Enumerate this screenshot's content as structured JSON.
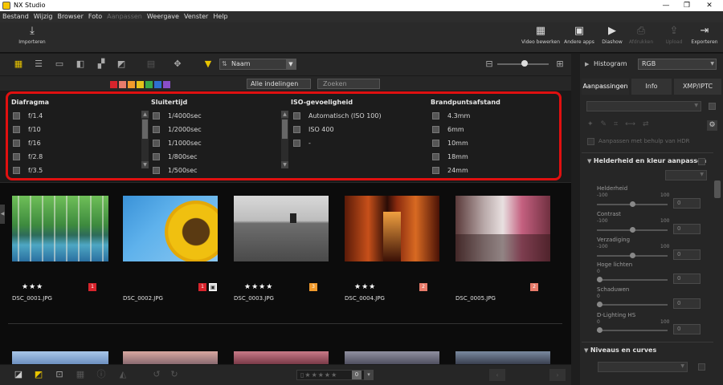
{
  "title_bar": {
    "app_title": "NX Studio",
    "minimize": "—",
    "maximize": "❐",
    "close": "✕"
  },
  "menu": [
    {
      "label": "Bestand",
      "enabled": true
    },
    {
      "label": "Wijzig",
      "enabled": true
    },
    {
      "label": "Browser",
      "enabled": true
    },
    {
      "label": "Foto",
      "enabled": true
    },
    {
      "label": "Aanpassen",
      "enabled": false
    },
    {
      "label": "Weergave",
      "enabled": true
    },
    {
      "label": "Venster",
      "enabled": true
    },
    {
      "label": "Help",
      "enabled": true
    }
  ],
  "toolbar": {
    "import": "Importeren",
    "movie_edit": "Video bewerken",
    "other_apps": "Andere apps",
    "slideshow": "Diashow",
    "print": "Afdrukken",
    "upload": "Upload",
    "export": "Exporteren"
  },
  "sort": {
    "label": "Naam"
  },
  "filter_bar": {
    "all_layouts": "Alle indelingen",
    "search_placeholder": "Zoeken"
  },
  "filter_panel": {
    "columns": [
      {
        "header": "Diafragma",
        "items": [
          "f/1.4",
          "f/10",
          "f/16",
          "f/2.8",
          "f/3.5"
        ]
      },
      {
        "header": "Sluitertijd",
        "items": [
          "1/4000sec",
          "1/2000sec",
          "1/1000sec",
          "1/800sec",
          "1/500sec"
        ]
      },
      {
        "header": "ISO-gevoeligheid",
        "items": [
          "Automatisch (ISO 100)",
          "ISO 400",
          "-"
        ]
      },
      {
        "header": "Brandpuntsafstand",
        "items": [
          "4.3mm",
          "6mm",
          "10mm",
          "18mm",
          "24mm"
        ]
      }
    ]
  },
  "thumbnails": [
    {
      "filename": "DSC_0001.JPG",
      "stars": "★★★",
      "badge": "1",
      "badge_color": "#d8242c"
    },
    {
      "filename": "DSC_0002.JPG",
      "stars": "",
      "badge": "1",
      "badge_color": "#d8242c"
    },
    {
      "filename": "DSC_0003.JPG",
      "stars": "★★★★",
      "badge": "3",
      "badge_color": "#f19a2c"
    },
    {
      "filename": "DSC_0004.JPG",
      "stars": "★★★",
      "badge": "2",
      "badge_color": "#e87b6a"
    },
    {
      "filename": "DSC_0005.JPG",
      "stars": "",
      "badge": "2",
      "badge_color": "#e87b6a"
    }
  ],
  "bottom_bar": {
    "rating_count": "0"
  },
  "right_panel": {
    "histogram_label": "Histogram",
    "histogram_mode": "RGB",
    "tabs": [
      "Aanpassingen",
      "Info",
      "XMP/IPTC"
    ],
    "ai_adjust_label": "Aanpassen met behulp van HDR",
    "section_brightness": "Helderheid en kleur aanpassen",
    "sliders": [
      {
        "label": "Helderheid",
        "min": "-100",
        "max": "100",
        "value": "0"
      },
      {
        "label": "Contrast",
        "min": "-100",
        "max": "100",
        "value": "0"
      },
      {
        "label": "Verzadiging",
        "min": "-100",
        "max": "100",
        "value": "0"
      },
      {
        "label": "Hoge lichten",
        "min": "0",
        "max": "",
        "value": "0"
      },
      {
        "label": "Schaduwen",
        "min": "0",
        "max": "",
        "value": "0"
      },
      {
        "label": "D-Lighting HS",
        "min": "0",
        "max": "100",
        "value": "0"
      }
    ],
    "section_levels": "Niveaus en curves"
  }
}
